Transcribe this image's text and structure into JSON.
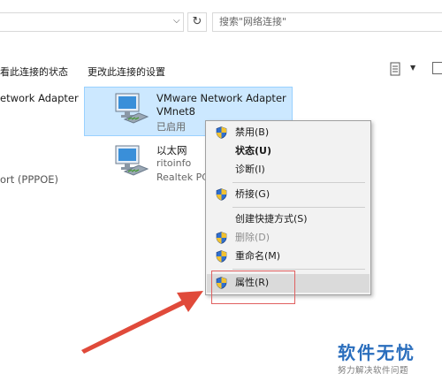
{
  "search": {
    "placeholder": "搜索\"网络连接\""
  },
  "command_bar": {
    "status_label": "看此连接的状态",
    "settings_label": "更改此连接的设置"
  },
  "left_partial": {
    "adapter_name": "etwork Adapter",
    "pppoe_type": "ort (PPPOE)"
  },
  "adapters": [
    {
      "name": "VMware Network Adapter",
      "line2": "VMnet8",
      "line3": "已启用"
    },
    {
      "name": "以太网",
      "line2": "ritoinfo",
      "line3": "Realtek PC"
    }
  ],
  "context_menu": {
    "items": [
      {
        "label": "禁用(B)",
        "icon": "shield-icon"
      },
      {
        "label": "状态(U)",
        "bold": true
      },
      {
        "label": "诊断(I)"
      },
      {
        "label": "桥接(G)",
        "icon": "shield-icon"
      },
      {
        "label": "创建快捷方式(S)"
      },
      {
        "label": "删除(D)",
        "icon": "shield-icon",
        "disabled": true
      },
      {
        "label": "重命名(M)",
        "icon": "shield-icon"
      },
      {
        "label": "属性(R)",
        "icon": "shield-icon",
        "highlighted": true
      }
    ]
  },
  "watermark": {
    "title": "软件无忧",
    "subtitle": "努力解决软件问题"
  },
  "colors": {
    "selection": "#cce8ff",
    "annotation": "#e04a3a",
    "watermark": "#2a6ebd"
  }
}
